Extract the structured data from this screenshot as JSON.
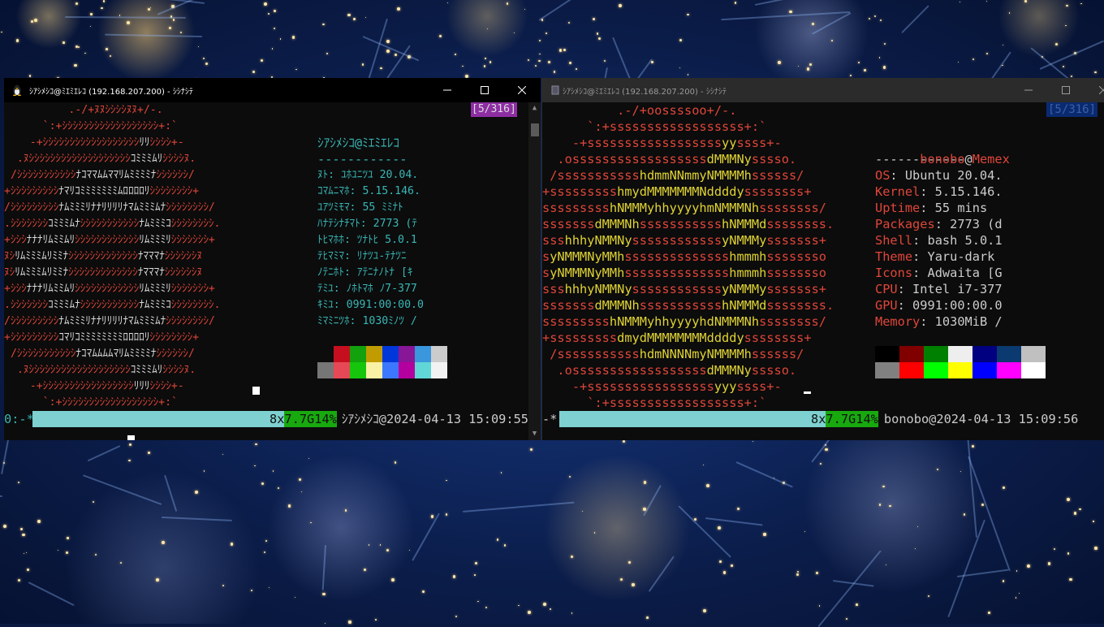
{
  "left_window": {
    "title": "ｼｱｼﾒｼｺ@ﾐｴﾐｴﾚｺ (192.168.207.200) - ｼｼﾅｼﾃ",
    "page_indicator": "[5/316]",
    "status": {
      "left": "0:-*",
      "mem": "8x",
      "mem_value": "7.7G",
      "percent": "14%",
      "host_time": "ｼｱｼﾒｼｺ@2024-04-13 15:09:55"
    }
  },
  "right_window": {
    "title": "ｼｱｼﾒｼｺ@ﾐｴﾐｴﾚｺ (192.168.207.200) - ｼｼﾅｼﾃ",
    "page_indicator": "[5/316]",
    "status": {
      "left": "-*",
      "mem": "8x",
      "mem_value": "7.7G",
      "percent": "14%",
      "host_time": "bonobo@2024-04-13 15:09:56"
    },
    "user": "bonobo",
    "at": "@",
    "host": "Memex",
    "separator": "------------",
    "info": [
      {
        "key": "OS",
        "value": ": Ubuntu 20.04."
      },
      {
        "key": "Kernel",
        "value": ": 5.15.146."
      },
      {
        "key": "Uptime",
        "value": ": 55 mins"
      },
      {
        "key": "Packages",
        "value": ": 2773 (d"
      },
      {
        "key": "Shell",
        "value": ": bash 5.0.1"
      },
      {
        "key": "Theme",
        "value": ": Yaru-dark"
      },
      {
        "key": "Icons",
        "value": ": Adwaita [G"
      },
      {
        "key": "CPU",
        "value": ": Intel i7-377"
      },
      {
        "key": "GPU",
        "value": ": 0991:00:00.0"
      },
      {
        "key": "Memory",
        "value": ": 1030MiB /"
      }
    ],
    "logo_lines": [
      "          .-/+oossssoo+/-.",
      "      `:+ssssssssssssssssss+:`",
      "    -+ssssssssssssssssssyyssss+-",
      "  .ossssssssssssssssssdMMMNysssso.",
      " /ssssssssssshdmmNNmmyNMMMMhssssss/",
      "+ssssssssshmydMMMMMMMNddddyssssssss+",
      "ssssssssshNMMMyhhyyyyhmNMMMNhssssssss/",
      "sssssssdMMMNhssssssssssshNMMMdssssssss.",
      "ssshhhyNMMNyssssssssssssyNMMMysssssss+",
      "syNMMMNyMMhsssssssssssssshmmmhssssssso",
      "syNMMMNyMMhsssssssssssssshmmmhssssssso",
      "ssshhhyNMMNyssssssssssssyNMMMysssssss+",
      "sssssssdMMMNhssssssssssshNMMMdssssssss.",
      "ssssssssshNMMMyhhyyyyhdNMMMNhssssssss/",
      "+sssssssssdmydMMMMMMMMddddyssssssss+",
      " /ssssssssssshdmNNNNmyNMMMMhssssss/",
      "  .ossssssssssssssssssdMMMNysssso.",
      "    -+sssssssssssssssssyyyssss+-",
      "      `:+ssssssssssssssssss+:`"
    ],
    "left_logo_lines": [
      "          .-/+ﾇﾇｼｼｼｼﾇﾇ+/-.",
      "      `:+ｼｼｼｼｼｼｼｼｼｼｼｼｼｼｼｼｼｼ+:`",
      "    -+ｼｼｼｼｼｼｼｼｼｼｼｼｼｼｼｼｼｼﾘﾘｼｼｼｼ+-",
      "  .ﾇｼｼｼｼｼｼｼｼｼｼｼｼｼｼｼｼｼｼｼｺﾐﾐﾐﾑﾘｼｼｼｼﾇ.",
      " /ｼｼｼｼｼｼｼｼｼｼｼﾅｺﾏﾏﾑﾑﾏﾏﾘﾑﾐﾐﾐﾐﾅｼｼｼｼｼｼ/",
      "+ｼｼｼｼｼｼｼｼｼﾅﾏﾘｺﾐﾐﾐﾐﾐﾐﾐﾑﾛﾛﾛﾛﾘｼｼｼｼｼｼｼｼ+",
      "/ｼｼｼｼｼｼｼｼｼﾅﾑﾐﾐﾐﾘﾅﾅﾘﾘﾘﾘﾅﾏﾑﾐﾐﾐﾑﾅｼｼｼｼｼｼｼｼ/",
      ".ｼｼｼｼｼｼｼｺﾐﾐﾐﾑﾅｼｼｼｼｼｼｼｼｼｼｼﾅﾑﾐﾐﾐｺｼｼｼｼｼｼｼｼ.",
      "+ｼｼｼﾅﾅﾅﾘﾑﾐﾐﾑﾘｼｼｼｼｼｼｼｼｼｼｼｼﾘﾑﾐﾐﾐﾘｼｼｼｼｼｼｼ+",
      "ﾇｼﾘﾑﾐﾐﾐﾑﾘﾐﾐﾅｼｼｼｼｼｼｼｼｼｼｼｼｼﾅﾏﾏﾏﾅｼｼｼｼｼｼﾇ",
      "ﾇｼﾘﾑﾐﾐﾐﾑﾘﾐﾐﾅｼｼｼｼｼｼｼｼｼｼｼｼｼﾅﾏﾏﾏﾅｼｼｼｼｼｼﾇ",
      "+ｼｼｼﾅﾅﾅﾘﾑﾐﾐﾑﾘｼｼｼｼｼｼｼｼｼｼｼｼﾘﾑﾐﾐﾐﾘｼｼｼｼｼｼｼ+",
      ".ｼｼｼｼｼｼｼｺﾐﾐﾐﾑﾅｼｼｼｼｼｼｼｼｼｼｼﾅﾑﾐﾐﾐｺｼｼｼｼｼｼｼｼ.",
      "/ｼｼｼｼｼｼｼｼｼﾅﾑﾐﾐﾐﾘﾅﾅﾘﾘﾘﾘﾅﾏﾑﾐﾐﾐﾑﾅｼｼｼｼｼｼｼｼ/",
      "+ｼｼｼｼｼｼｼｼｼｺﾏﾘｺﾐﾐﾐﾐﾐﾐﾐﾐﾛﾛﾛﾛﾘｼｼｼｼｼｼｼｼ+",
      " /ｼｼｼｼｼｼｼｼｼｼｼﾅｺﾏﾑﾑﾑﾑﾏﾘﾑﾐﾐﾐﾐﾅｼｼｼｼｼｼ/",
      "  .ﾇｼｼｼｼｼｼｼｼｼｼｼｼｼｼｼｼｼｼｼｺﾐﾐﾐﾑﾘｼｼｼｼﾇ.",
      "    -+ｼｼｼｼｼｼｼｼｼｼｼｼｼｼｼｼｼﾘﾘﾘｼｼｼｼ+-",
      "      `:+ｼｼｼｼｼｼｼｼｼｼｼｼｼｼｼｼｼｼ+:`"
    ],
    "left_user_host": "ｼｱｼﾒｼｺ@ﾐｴﾐｴﾚｺ",
    "left_info": [
      "ﾇﾄ: ﾕﾎﾕﾆﾂﾕ 20.04.",
      "ｺﾏﾑﾆﾏﾎ: 5.15.146.",
      "ﾕｱﾂﾐﾓﾏ: 55 ﾐﾐﾅﾄ",
      "ﾊﾅﾃｼﾅﾁﾏﾄ: 2773 (ﾃ",
      "ﾄﾋﾏﾎﾎ: ﾂﾅﾄﾋ 5.0.1",
      "ﾃﾋﾏﾐﾏ: ﾘﾅﾂﾕ-ﾃﾅﾂﾆ",
      "ﾉﾃﾆﾎﾄ: ｱﾃﾆﾅﾉﾄﾅ [ｷ",
      "ﾃﾐﾕ: ﾉﾎﾄﾏﾎ ﾉ7-377",
      "ｷﾐﾕ: 0991:00:00.0",
      "ﾐﾏﾐﾆﾂﾎ: 1030ﾐﾉﾂ /"
    ]
  },
  "colors": {
    "left_cyan": "#3ab6b6",
    "right_red": "#e0463a",
    "right_yellow": "#e0d334",
    "status_bg": "#7fd0d0",
    "status_green": "#18a90f",
    "page_ind_purple": "#8e2ea3",
    "page_ind_blue": "#0a2a70",
    "palette_top": [
      "#0c0c0c",
      "#c50f1f",
      "#13a10e",
      "#c19c00",
      "#0037da",
      "#881798",
      "#3a96dd",
      "#cccccc"
    ],
    "palette_bottom": [
      "#767676",
      "#e74856",
      "#16c60c",
      "#f9f1a5",
      "#3b78ff",
      "#b4009e",
      "#61d6d6",
      "#f2f2f2"
    ],
    "palette_right_top": [
      "#000000",
      "#800000",
      "#008000",
      "#eeeeee",
      "#000080",
      "#0a3a70",
      "#c0c0c0"
    ],
    "palette_right_bottom": [
      "#808080",
      "#ff0000",
      "#00ff00",
      "#ffff00",
      "#0000ff",
      "#ff00ff",
      "#ffffff"
    ]
  },
  "icons": {
    "left_app": "tux-penguin-icon",
    "right_app": "terminal-icon",
    "minimize": "minimize-icon",
    "maximize": "maximize-icon",
    "close": "close-icon"
  }
}
